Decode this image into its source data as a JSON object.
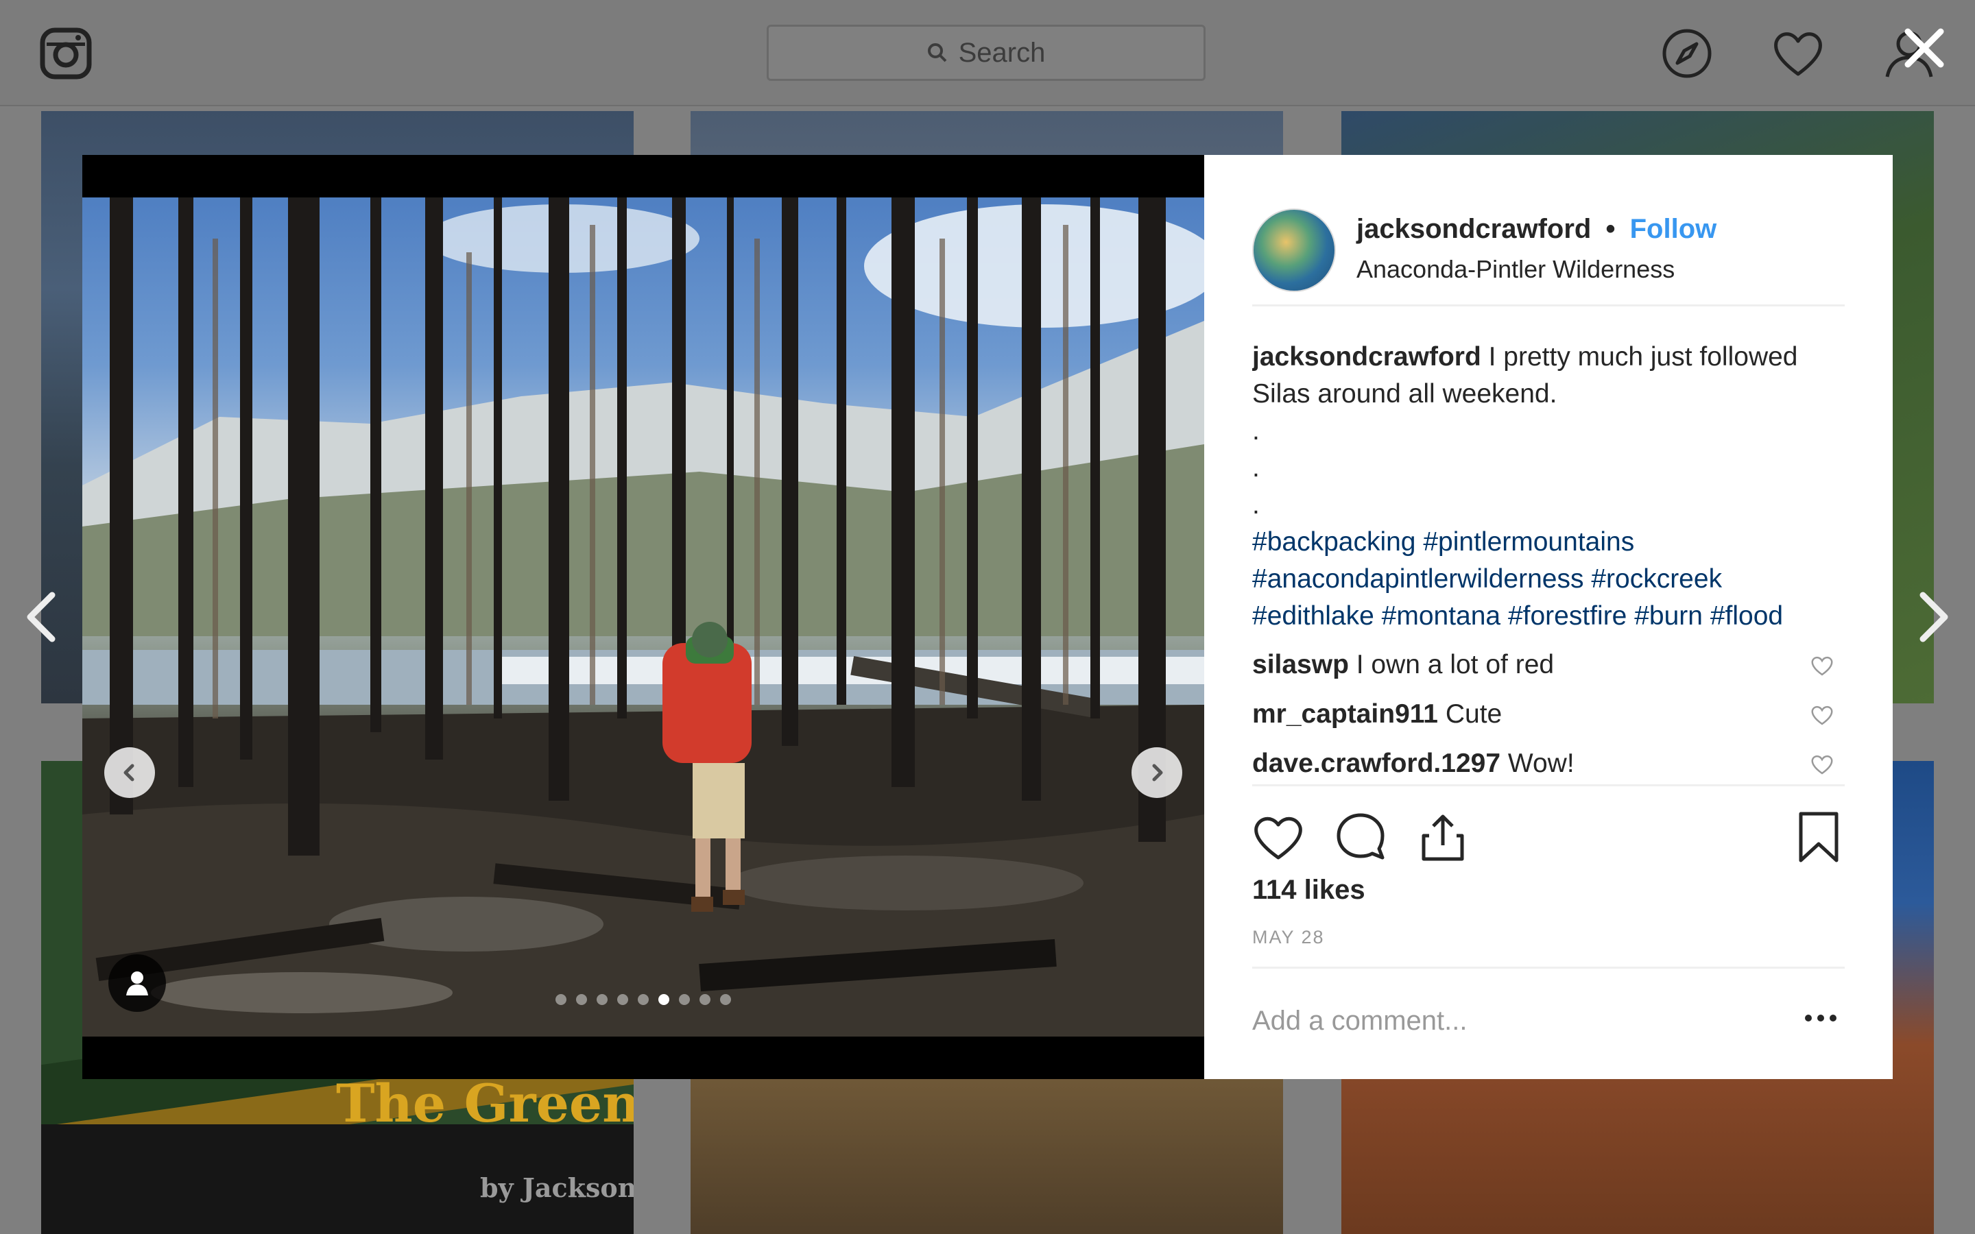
{
  "search": {
    "placeholder": "Search"
  },
  "background_tiles": {
    "tile4_title": "The Green",
    "tile4_subtitle": "by Jackson"
  },
  "post": {
    "username": "jacksondcrawford",
    "follow_label": "Follow",
    "separator": "•",
    "location": "Anaconda-Pintler Wilderness",
    "caption_text": "I pretty much just followed Silas around all weekend.",
    "caption_dots": [
      ".",
      ".",
      "."
    ],
    "hashtags": [
      "#backpacking",
      "#pintlermountains",
      "#anacondapintlerwilderness",
      "#rockcreek",
      "#edithlake",
      "#montana",
      "#forestfire",
      "#burn",
      "#flood"
    ],
    "comments": [
      {
        "user": "silaswp",
        "text": "I own a lot of red"
      },
      {
        "user": "mr_captain911",
        "text": "Cute"
      },
      {
        "user": "dave.crawford.1297",
        "text": "Wow!"
      }
    ],
    "likes": "114 likes",
    "date": "MAY 28",
    "add_comment_placeholder": "Add a comment...",
    "carousel": {
      "count": 9,
      "active_index": 5
    }
  },
  "icons": {
    "logo": "instagram-icon",
    "explore": "compass-icon",
    "activity": "heart-icon",
    "profile": "user-icon",
    "close": "close-icon"
  }
}
